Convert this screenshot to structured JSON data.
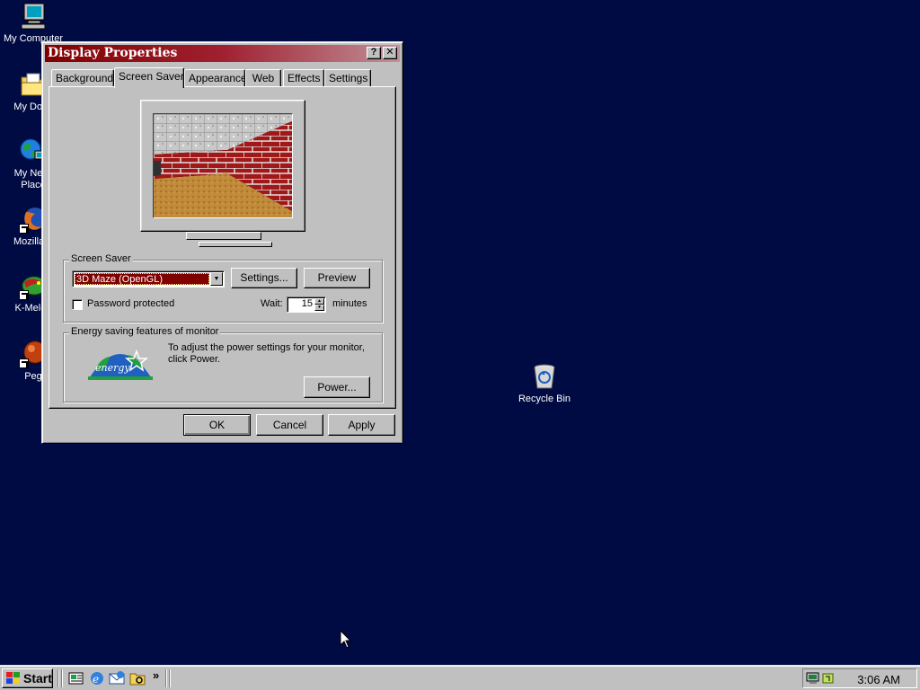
{
  "desktop": {
    "icons": [
      {
        "label": "My Computer"
      },
      {
        "label": "My Docu"
      },
      {
        "label": "My Netw",
        "label2": "Place"
      },
      {
        "label": "Mozilla F"
      },
      {
        "label": "K-Meleo"
      },
      {
        "label": "Peg"
      }
    ],
    "recycle_bin": {
      "label": "Recycle Bin"
    }
  },
  "window": {
    "title": "Display Properties",
    "help_glyph": "?",
    "close_glyph": "✕",
    "tabs": [
      {
        "label": "Background"
      },
      {
        "label": "Screen Saver"
      },
      {
        "label": "Appearance"
      },
      {
        "label": "Web"
      },
      {
        "label": "Effects"
      },
      {
        "label": "Settings"
      }
    ],
    "active_tab": "Screen Saver",
    "screensaver": {
      "group_label": "Screen Saver",
      "selected": "3D Maze (OpenGL)",
      "settings_button": "Settings...",
      "preview_button": "Preview",
      "password_label": "Password protected",
      "password_checked": false,
      "wait_label": "Wait:",
      "wait_value": "15",
      "wait_unit": "minutes"
    },
    "energy": {
      "group_label": "Energy saving features of monitor",
      "logo_text": "energy",
      "text": "To adjust the power settings for your monitor, click Power.",
      "power_button": "Power..."
    },
    "buttons": {
      "ok": "OK",
      "cancel": "Cancel",
      "apply": "Apply"
    }
  },
  "taskbar": {
    "start_label": "Start",
    "quicklaunch_more": "»",
    "clock": "3:06 AM"
  },
  "colors": {
    "desktop": "#000b43",
    "title_active": "#800000",
    "selection": "#800000",
    "face": "#c0c0c0"
  }
}
